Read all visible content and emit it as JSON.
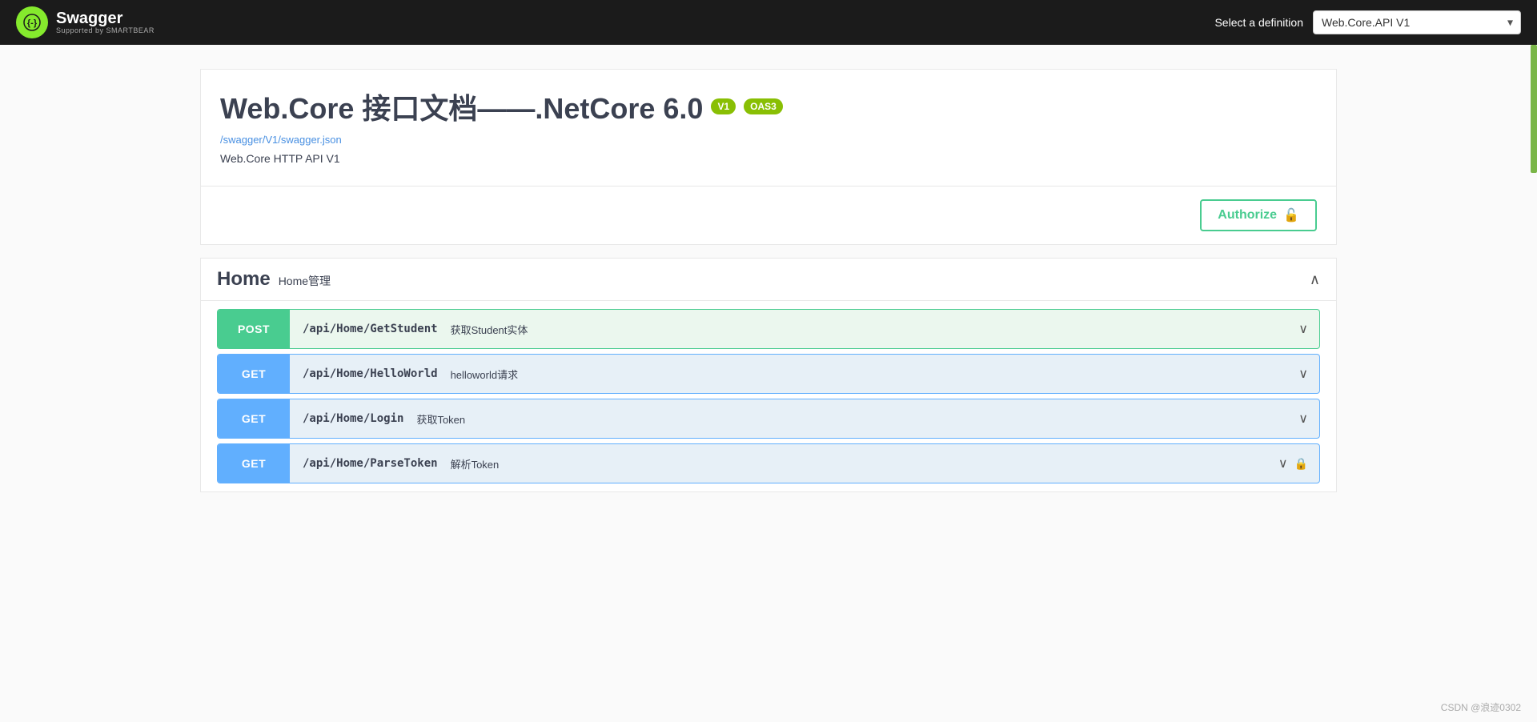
{
  "header": {
    "logo_text": "{-}",
    "brand_name": "Swagger",
    "brand_sub": "Supported by SMARTBEAR",
    "select_label": "Select a definition",
    "definition_value": "Web.Core.API V1",
    "definition_options": [
      "Web.Core.API V1"
    ]
  },
  "page_title": {
    "title": "Web.Core 接口文档——.NetCore 6.0",
    "badge_v1": "V1",
    "badge_oas3": "OAS3",
    "link": "/swagger/V1/swagger.json",
    "description": "Web.Core HTTP API V1"
  },
  "authorize_btn": "Authorize",
  "section": {
    "name": "Home",
    "description": "Home管理",
    "chevron": "∧"
  },
  "api_rows": [
    {
      "method": "POST",
      "path": "/api/Home/GetStudent",
      "description": "获取Student实体",
      "has_lock": false
    },
    {
      "method": "GET",
      "path": "/api/Home/HelloWorld",
      "description": "helloworld请求",
      "has_lock": false
    },
    {
      "method": "GET",
      "path": "/api/Home/Login",
      "description": "获取Token",
      "has_lock": false
    },
    {
      "method": "GET",
      "path": "/api/Home/ParseToken",
      "description": "解析Token",
      "has_lock": true
    }
  ],
  "footer": {
    "watermark": "CSDN @浪迹0302"
  }
}
